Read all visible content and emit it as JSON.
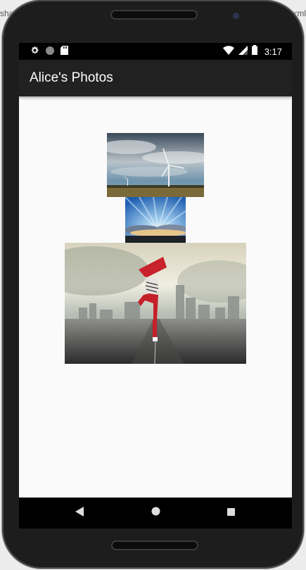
{
  "background_window": {
    "left_fragment": "shar",
    "right_fragment": "xml"
  },
  "status_bar": {
    "time": "3:17",
    "left_icons": [
      "gear-icon",
      "circle-icon",
      "sd-card-icon"
    ],
    "right_icons": [
      "wifi-icon",
      "signal-icon",
      "battery-icon"
    ]
  },
  "app_bar": {
    "title": "Alice's Photos",
    "color": "#212121"
  },
  "photos": [
    {
      "subject": "wind turbine under cloudy sky"
    },
    {
      "subject": "sun rays over clouds"
    },
    {
      "subject": "dancer with red scarf on road before city"
    }
  ],
  "nav_bar": {
    "buttons": [
      "back-icon",
      "home-icon",
      "recents-icon"
    ]
  },
  "colors": {
    "screen_background": "#fafafa",
    "status_bar": "#000000",
    "nav_bar": "#000000"
  }
}
